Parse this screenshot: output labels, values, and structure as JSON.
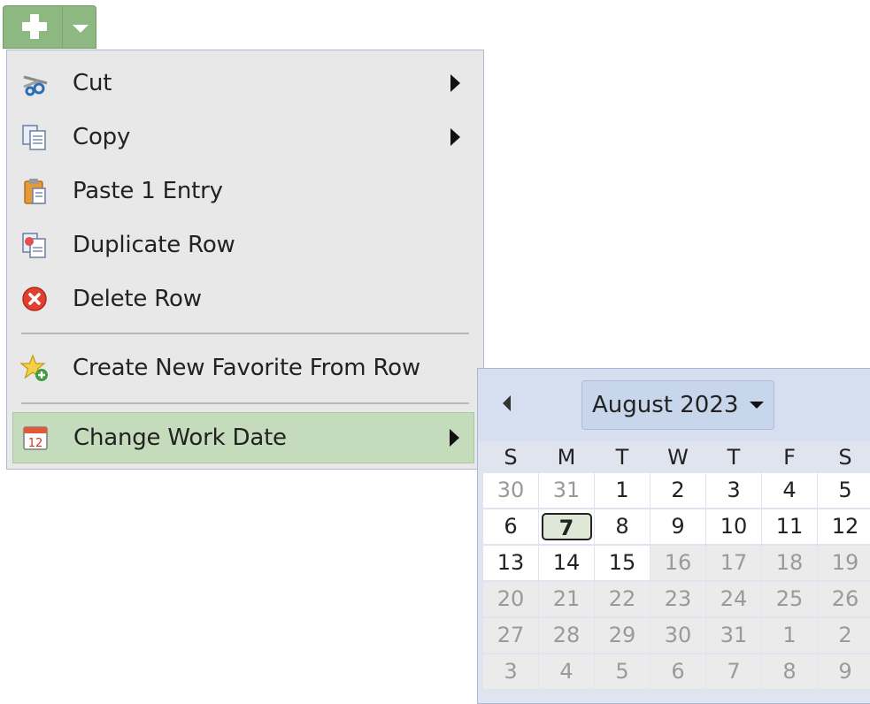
{
  "toolbar": {
    "add_icon": "plus-icon",
    "dropdown_icon": "caret-down-icon",
    "accent": "#8db882"
  },
  "menu": {
    "items": [
      {
        "label": "Cut",
        "icon": "scissors-icon",
        "has_submenu": true
      },
      {
        "label": "Copy",
        "icon": "copy-icon",
        "has_submenu": true
      },
      {
        "label": "Paste 1 Entry",
        "icon": "clipboard-icon",
        "has_submenu": false
      },
      {
        "label": "Duplicate Row",
        "icon": "duplicate-icon",
        "has_submenu": false
      },
      {
        "label": "Delete Row",
        "icon": "delete-icon",
        "has_submenu": false
      },
      {
        "label": "Create New Favorite From Row",
        "icon": "favorite-star-add-icon",
        "has_submenu": false
      },
      {
        "label": "Change Work Date",
        "icon": "calendar-icon",
        "has_submenu": true,
        "active": true
      }
    ],
    "active_color": "#c5dcbc"
  },
  "calendar": {
    "month_label": "August 2023",
    "weekdays": [
      "S",
      "M",
      "T",
      "W",
      "T",
      "F",
      "S"
    ],
    "weeks": [
      [
        "30",
        "31",
        "1",
        "2",
        "3",
        "4",
        "5"
      ],
      [
        "6",
        "7",
        "8",
        "9",
        "10",
        "11",
        "12"
      ],
      [
        "13",
        "14",
        "15",
        "16",
        "17",
        "18",
        "19"
      ],
      [
        "20",
        "21",
        "22",
        "23",
        "24",
        "25",
        "26"
      ],
      [
        "27",
        "28",
        "29",
        "30",
        "31",
        "1",
        "2"
      ],
      [
        "3",
        "4",
        "5",
        "6",
        "7",
        "8",
        "9"
      ]
    ],
    "selected_day": "7",
    "last_selectable_day": "15"
  }
}
